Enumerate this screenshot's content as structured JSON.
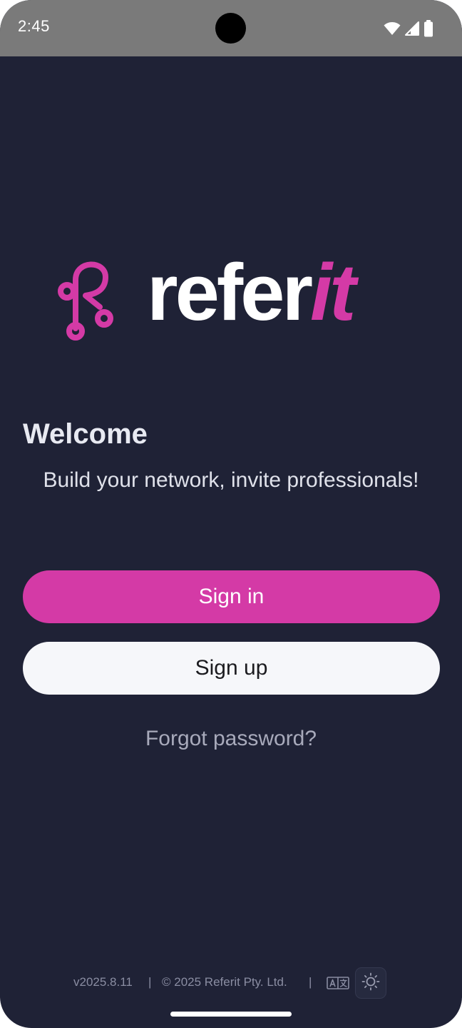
{
  "status_bar": {
    "time": "2:45",
    "icons": [
      "wifi-icon",
      "signal-icon",
      "battery-icon"
    ]
  },
  "logo": {
    "word_part1": "refer",
    "word_part2": "it",
    "mark_icon": "referit-logo-mark"
  },
  "welcome": {
    "title": "Welcome",
    "subtitle": "Build your network, invite professionals!"
  },
  "actions": {
    "sign_in_label": "Sign in",
    "sign_up_label": "Sign up",
    "forgot_password_label": "Forgot password?"
  },
  "footer": {
    "version": "v2025.8.11",
    "separator": "|",
    "copyright": "© 2025 Referit Pty. Ltd.",
    "translate_icon": "translate-icon",
    "theme_icon": "sun-icon"
  },
  "colors": {
    "background": "#1f2236",
    "accent": "#d43aa6",
    "status_bar": "#7a7a7a",
    "secondary_button": "#f6f7fa"
  }
}
